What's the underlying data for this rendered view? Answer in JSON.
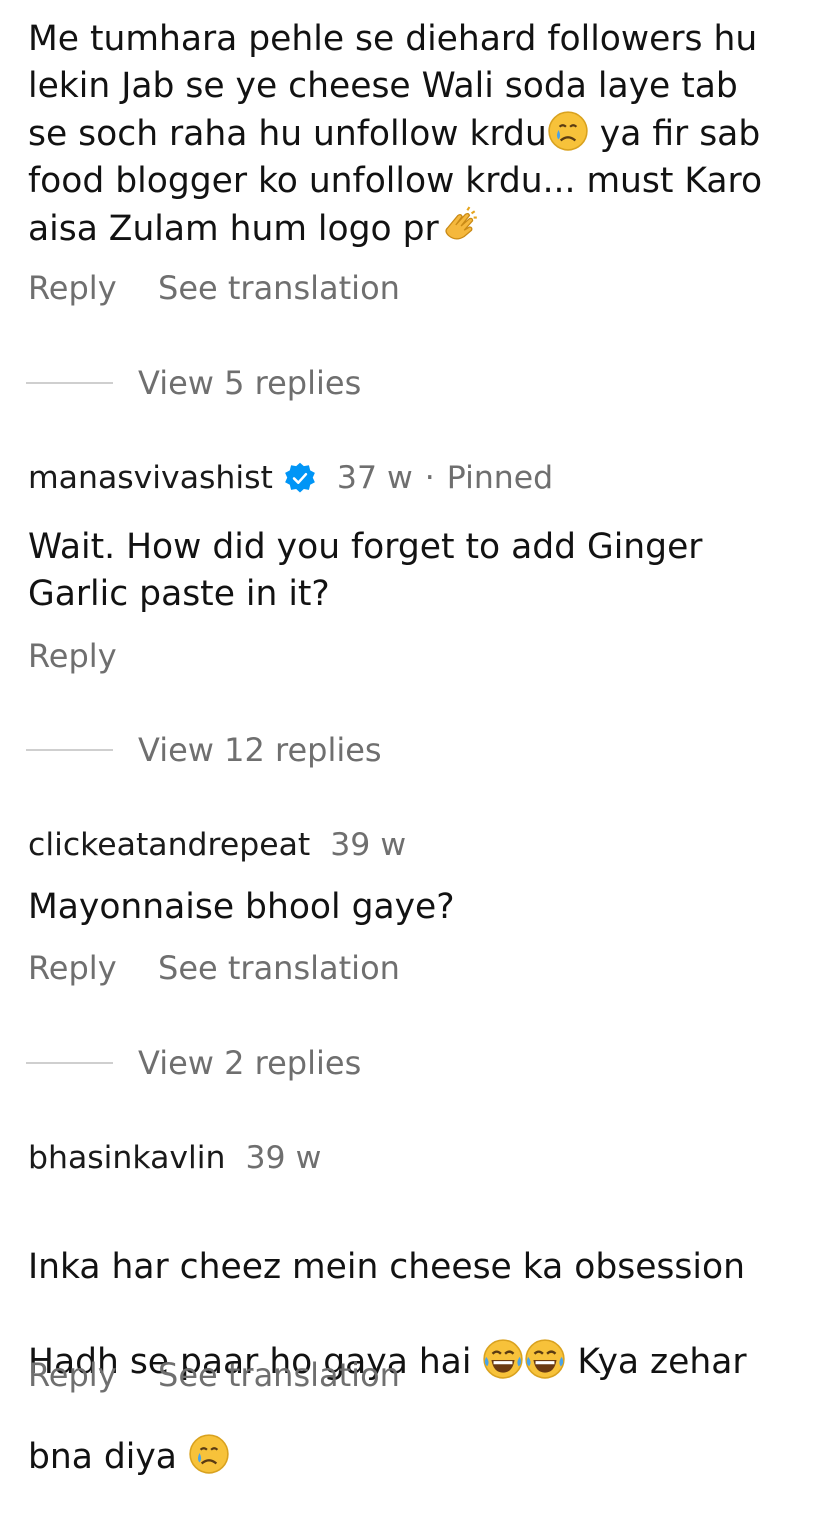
{
  "comments": [
    {
      "text_before": "Me tumhara pehle se diehard followers hu\nlekin Jab se ye cheese Wali soda laye tab\nse soch raha hu unfollow krdu",
      "text_after": " ya fir sab\nfood blogger ko unfollow krdu... must Karo\naisa Zulam hum logo pr",
      "reply_label": "Reply",
      "translate_label": "See translation",
      "view_replies": "View 5 replies"
    },
    {
      "username": "manasvivashist",
      "time": "37 w",
      "dot": "·",
      "pinned": "Pinned",
      "text": "Wait. How did you forget to add Ginger\nGarlic paste in it?",
      "reply_label": "Reply",
      "view_replies": "View 12 replies"
    },
    {
      "username": "clickeatandrepeat",
      "time": "39 w",
      "text": "Mayonnaise bhool gaye?",
      "reply_label": "Reply",
      "translate_label": "See translation",
      "view_replies": "View 2 replies"
    },
    {
      "username": "bhasinkavlin",
      "time": "39 w",
      "text_line1": "Inka har cheez mein cheese ka obsession",
      "text_line2_before": "Hadh se paar ho gaya hai ",
      "text_line2_after": " Kya zehar",
      "text_line3": "bna diya ",
      "reply_label": "Reply",
      "translate_label": "See translation"
    }
  ],
  "icons": {
    "verified": "verified-badge-icon",
    "crying": "crying-face-icon",
    "clapping": "clapping-hands-icon",
    "tears_of_joy": "tears-of-joy-icon"
  },
  "colors": {
    "text": "#121212",
    "secondary": "#6f6f6f",
    "verified": "#0095f6"
  }
}
